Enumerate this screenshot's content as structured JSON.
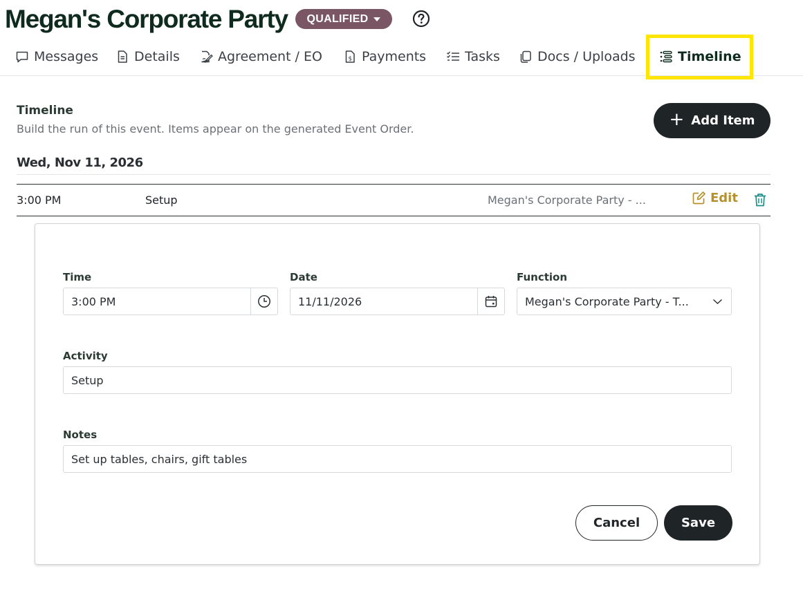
{
  "header": {
    "title": "Megan's Corporate Party",
    "status": "QUALIFIED",
    "help_icon": "question-circle-icon"
  },
  "tabs": [
    {
      "label": "Messages",
      "icon": "message-icon"
    },
    {
      "label": "Details",
      "icon": "document-icon"
    },
    {
      "label": "Agreement / EO",
      "icon": "signature-icon"
    },
    {
      "label": "Payments",
      "icon": "invoice-dollar-icon"
    },
    {
      "label": "Tasks",
      "icon": "checklist-icon"
    },
    {
      "label": "Docs / Uploads",
      "icon": "copy-icon"
    },
    {
      "label": "Timeline",
      "icon": "timeline-icon",
      "active": true
    }
  ],
  "timeline": {
    "title": "Timeline",
    "subtitle": "Build the run of this event. Items appear on the generated Event Order.",
    "add_label": "Add Item",
    "date_header": "Wed, Nov 11, 2026",
    "items": [
      {
        "time": "3:00 PM",
        "activity": "Setup",
        "function": "Megan's Corporate Party - ...",
        "edit_label": "Edit"
      }
    ]
  },
  "form": {
    "time_label": "Time",
    "time_value": "3:00 PM",
    "date_label": "Date",
    "date_value": "11/11/2026",
    "function_label": "Function",
    "function_value": "Megan's Corporate Party - T...",
    "activity_label": "Activity",
    "activity_value": "Setup",
    "notes_label": "Notes",
    "notes_value": "Set up tables, chairs, gift tables",
    "cancel_label": "Cancel",
    "save_label": "Save"
  },
  "colors": {
    "brand_dark": "#0f2a1e",
    "status_badge": "#7a5564",
    "edit_gold": "#b6902b",
    "trash_teal": "#1a8f8a",
    "highlight": "#ffe600",
    "button_dark": "#1f2427"
  }
}
